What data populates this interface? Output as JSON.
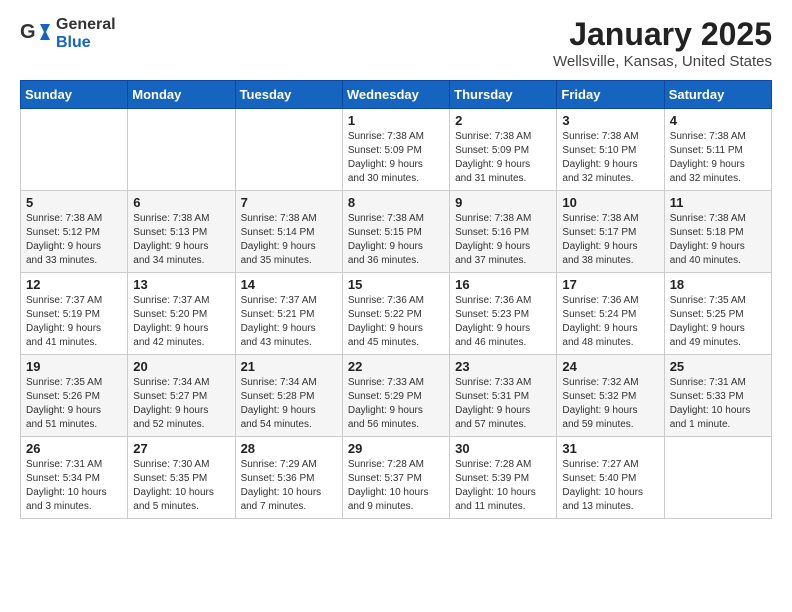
{
  "header": {
    "logo_general": "General",
    "logo_blue": "Blue",
    "month": "January 2025",
    "location": "Wellsville, Kansas, United States"
  },
  "weekdays": [
    "Sunday",
    "Monday",
    "Tuesday",
    "Wednesday",
    "Thursday",
    "Friday",
    "Saturday"
  ],
  "weeks": [
    {
      "shaded": false,
      "days": [
        {
          "num": "",
          "info": ""
        },
        {
          "num": "",
          "info": ""
        },
        {
          "num": "",
          "info": ""
        },
        {
          "num": "1",
          "info": "Sunrise: 7:38 AM\nSunset: 5:09 PM\nDaylight: 9 hours\nand 30 minutes."
        },
        {
          "num": "2",
          "info": "Sunrise: 7:38 AM\nSunset: 5:09 PM\nDaylight: 9 hours\nand 31 minutes."
        },
        {
          "num": "3",
          "info": "Sunrise: 7:38 AM\nSunset: 5:10 PM\nDaylight: 9 hours\nand 32 minutes."
        },
        {
          "num": "4",
          "info": "Sunrise: 7:38 AM\nSunset: 5:11 PM\nDaylight: 9 hours\nand 32 minutes."
        }
      ]
    },
    {
      "shaded": true,
      "days": [
        {
          "num": "5",
          "info": "Sunrise: 7:38 AM\nSunset: 5:12 PM\nDaylight: 9 hours\nand 33 minutes."
        },
        {
          "num": "6",
          "info": "Sunrise: 7:38 AM\nSunset: 5:13 PM\nDaylight: 9 hours\nand 34 minutes."
        },
        {
          "num": "7",
          "info": "Sunrise: 7:38 AM\nSunset: 5:14 PM\nDaylight: 9 hours\nand 35 minutes."
        },
        {
          "num": "8",
          "info": "Sunrise: 7:38 AM\nSunset: 5:15 PM\nDaylight: 9 hours\nand 36 minutes."
        },
        {
          "num": "9",
          "info": "Sunrise: 7:38 AM\nSunset: 5:16 PM\nDaylight: 9 hours\nand 37 minutes."
        },
        {
          "num": "10",
          "info": "Sunrise: 7:38 AM\nSunset: 5:17 PM\nDaylight: 9 hours\nand 38 minutes."
        },
        {
          "num": "11",
          "info": "Sunrise: 7:38 AM\nSunset: 5:18 PM\nDaylight: 9 hours\nand 40 minutes."
        }
      ]
    },
    {
      "shaded": false,
      "days": [
        {
          "num": "12",
          "info": "Sunrise: 7:37 AM\nSunset: 5:19 PM\nDaylight: 9 hours\nand 41 minutes."
        },
        {
          "num": "13",
          "info": "Sunrise: 7:37 AM\nSunset: 5:20 PM\nDaylight: 9 hours\nand 42 minutes."
        },
        {
          "num": "14",
          "info": "Sunrise: 7:37 AM\nSunset: 5:21 PM\nDaylight: 9 hours\nand 43 minutes."
        },
        {
          "num": "15",
          "info": "Sunrise: 7:36 AM\nSunset: 5:22 PM\nDaylight: 9 hours\nand 45 minutes."
        },
        {
          "num": "16",
          "info": "Sunrise: 7:36 AM\nSunset: 5:23 PM\nDaylight: 9 hours\nand 46 minutes."
        },
        {
          "num": "17",
          "info": "Sunrise: 7:36 AM\nSunset: 5:24 PM\nDaylight: 9 hours\nand 48 minutes."
        },
        {
          "num": "18",
          "info": "Sunrise: 7:35 AM\nSunset: 5:25 PM\nDaylight: 9 hours\nand 49 minutes."
        }
      ]
    },
    {
      "shaded": true,
      "days": [
        {
          "num": "19",
          "info": "Sunrise: 7:35 AM\nSunset: 5:26 PM\nDaylight: 9 hours\nand 51 minutes."
        },
        {
          "num": "20",
          "info": "Sunrise: 7:34 AM\nSunset: 5:27 PM\nDaylight: 9 hours\nand 52 minutes."
        },
        {
          "num": "21",
          "info": "Sunrise: 7:34 AM\nSunset: 5:28 PM\nDaylight: 9 hours\nand 54 minutes."
        },
        {
          "num": "22",
          "info": "Sunrise: 7:33 AM\nSunset: 5:29 PM\nDaylight: 9 hours\nand 56 minutes."
        },
        {
          "num": "23",
          "info": "Sunrise: 7:33 AM\nSunset: 5:31 PM\nDaylight: 9 hours\nand 57 minutes."
        },
        {
          "num": "24",
          "info": "Sunrise: 7:32 AM\nSunset: 5:32 PM\nDaylight: 9 hours\nand 59 minutes."
        },
        {
          "num": "25",
          "info": "Sunrise: 7:31 AM\nSunset: 5:33 PM\nDaylight: 10 hours\nand 1 minute."
        }
      ]
    },
    {
      "shaded": false,
      "days": [
        {
          "num": "26",
          "info": "Sunrise: 7:31 AM\nSunset: 5:34 PM\nDaylight: 10 hours\nand 3 minutes."
        },
        {
          "num": "27",
          "info": "Sunrise: 7:30 AM\nSunset: 5:35 PM\nDaylight: 10 hours\nand 5 minutes."
        },
        {
          "num": "28",
          "info": "Sunrise: 7:29 AM\nSunset: 5:36 PM\nDaylight: 10 hours\nand 7 minutes."
        },
        {
          "num": "29",
          "info": "Sunrise: 7:28 AM\nSunset: 5:37 PM\nDaylight: 10 hours\nand 9 minutes."
        },
        {
          "num": "30",
          "info": "Sunrise: 7:28 AM\nSunset: 5:39 PM\nDaylight: 10 hours\nand 11 minutes."
        },
        {
          "num": "31",
          "info": "Sunrise: 7:27 AM\nSunset: 5:40 PM\nDaylight: 10 hours\nand 13 minutes."
        },
        {
          "num": "",
          "info": ""
        }
      ]
    }
  ]
}
